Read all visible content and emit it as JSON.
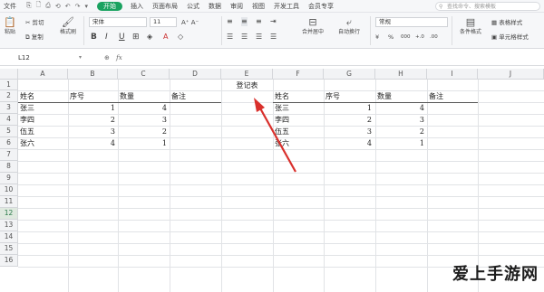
{
  "menubar": {
    "file": "文件",
    "quick_access": [
      "⎘",
      "🗋",
      "⎙",
      "⟲",
      "↶",
      "↷",
      "▾"
    ],
    "start": "开始",
    "tabs": [
      "插入",
      "页面布局",
      "公式",
      "数据",
      "审阅",
      "视图",
      "开发工具",
      "会员专享"
    ],
    "search_placeholder": "查找命令、搜索模板"
  },
  "ribbon": {
    "cut": "剪切",
    "copy": "复制",
    "format_painter": "格式刷",
    "paste": "粘贴",
    "font_name": "宋体",
    "font_size": "11",
    "bold": "B",
    "italic": "I",
    "underline": "U",
    "merge_center": "合并居中",
    "wrap_text": "自动换行",
    "number_format": "常规",
    "currency": "¥",
    "percent": "%",
    "thousands": "000",
    "inc_decimal": "+.0",
    "dec_decimal": ".00",
    "table_style": "表格样式",
    "cond_format": "条件格式",
    "cell_style": "单元格样式"
  },
  "formula_bar": {
    "cell_ref": "L12",
    "fx": "fx"
  },
  "columns": [
    "A",
    "B",
    "C",
    "D",
    "E",
    "F",
    "G",
    "H",
    "I",
    "J"
  ],
  "rows": [
    "1",
    "2",
    "3",
    "4",
    "5",
    "6",
    "7",
    "8",
    "9",
    "10",
    "11",
    "12",
    "13",
    "14",
    "15",
    "16"
  ],
  "selected_row": "12",
  "sheet": {
    "title": "登记表",
    "left_headers": [
      "姓名",
      "序号",
      "数量",
      "备注"
    ],
    "right_headers": [
      "姓名",
      "序号",
      "数量",
      "备注"
    ],
    "left_rows": [
      {
        "name": "张三",
        "seq": "1",
        "qty": "4"
      },
      {
        "name": "李四",
        "seq": "2",
        "qty": "3"
      },
      {
        "name": "伍五",
        "seq": "3",
        "qty": "2"
      },
      {
        "name": "张六",
        "seq": "4",
        "qty": "1"
      }
    ],
    "right_rows": [
      {
        "name": "张三",
        "seq": "1",
        "qty": "4"
      },
      {
        "name": "李四",
        "seq": "2",
        "qty": "3"
      },
      {
        "name": "伍五",
        "seq": "3",
        "qty": "2"
      },
      {
        "name": "张六",
        "seq": "4",
        "qty": "1"
      }
    ]
  },
  "watermark": "爱上手游网",
  "colors": {
    "accent_green": "#1aa260",
    "arrow_red": "#d9302c"
  }
}
